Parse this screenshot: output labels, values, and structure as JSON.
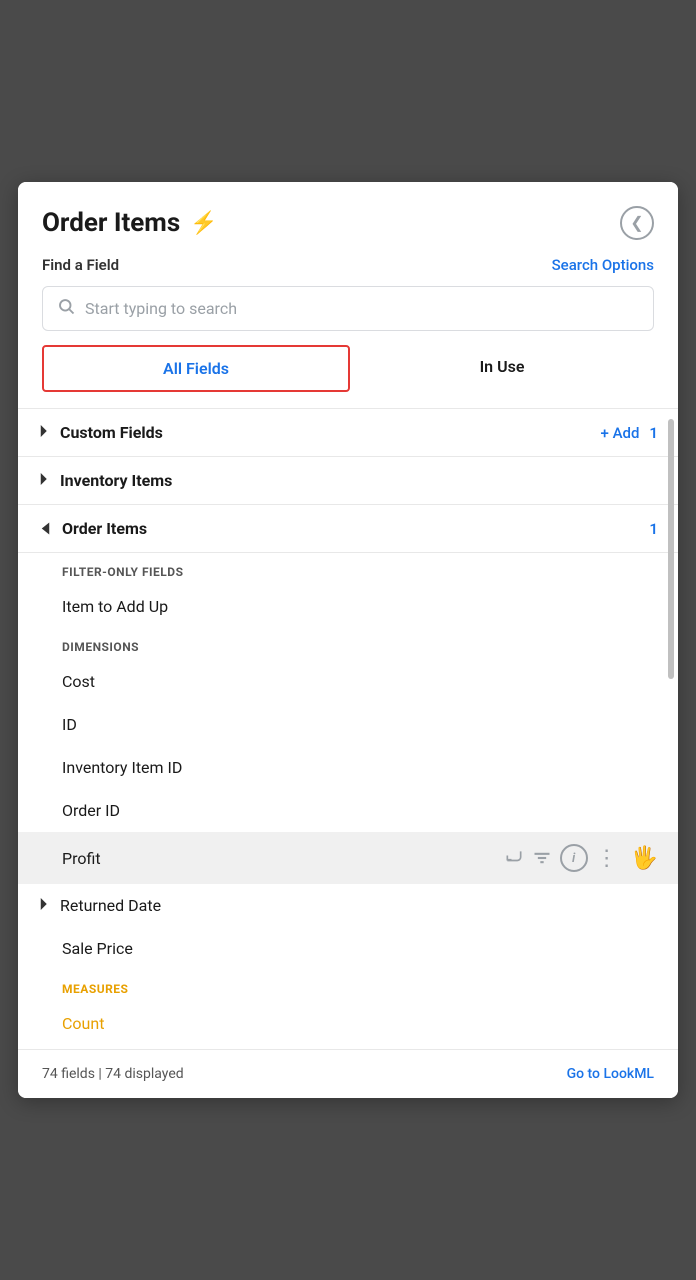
{
  "header": {
    "title": "Order Items",
    "find_field_label": "Find a Field",
    "search_options_label": "Search Options",
    "search_placeholder": "Start typing to search",
    "back_icon": "‹"
  },
  "tabs": {
    "all_fields": "All Fields",
    "in_use": "In Use"
  },
  "sections": {
    "custom_fields": {
      "label": "Custom Fields",
      "add_label": "+ Add",
      "count": "1"
    },
    "inventory_items": {
      "label": "Inventory Items"
    },
    "order_items": {
      "label": "Order Items",
      "count": "1",
      "filter_only_label": "FILTER-ONLY FIELDS",
      "filter_only_items": [
        "Item to Add Up"
      ],
      "dimensions_label": "DIMENSIONS",
      "dimension_items": [
        "Cost",
        "ID",
        "Inventory Item ID",
        "Order ID",
        "Profit"
      ],
      "returned_date": "Returned Date",
      "sale_price": "Sale Price",
      "measures_label": "MEASURES",
      "measure_items": [
        "Count"
      ]
    }
  },
  "footer": {
    "count_label": "74 fields | 74 displayed",
    "lookaml_link": "Go to LookML"
  },
  "icons": {
    "lightning": "⚡",
    "search": "🔍",
    "back": "❮",
    "chevron_right": "▶",
    "chevron_down": "▼",
    "return": "↵",
    "filter": "≡",
    "info": "i",
    "more": "⋮"
  }
}
